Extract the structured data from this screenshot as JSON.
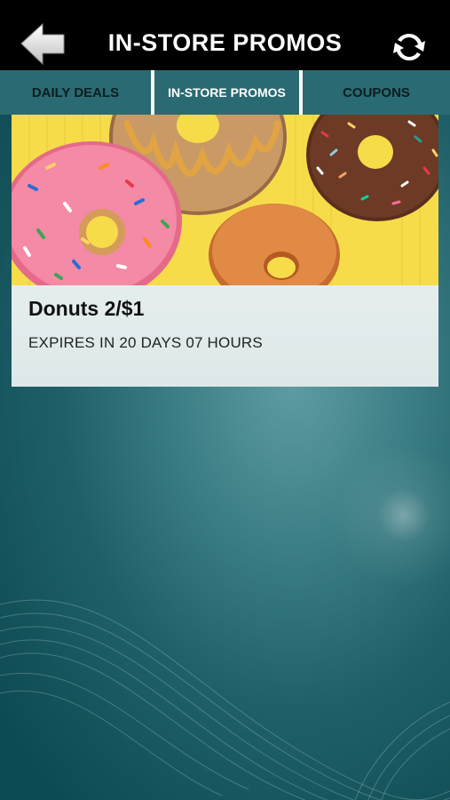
{
  "header": {
    "title": "IN-STORE PROMOS",
    "back_icon": "back-arrow-icon",
    "refresh_icon": "refresh-icon"
  },
  "tabs": [
    {
      "label": "DAILY DEALS",
      "selected": false
    },
    {
      "label": "IN-STORE PROMOS",
      "selected": true
    },
    {
      "label": "COUPONS",
      "selected": false
    }
  ],
  "promos": [
    {
      "title": "Donuts 2/$1",
      "expiry": "EXPIRES IN 20 DAYS 07 HOURS",
      "image": "donuts-photo"
    }
  ],
  "colors": {
    "topbar": "#000000",
    "tabbar": "#2a6a72",
    "accent_yellow": "#f7dc4a"
  }
}
